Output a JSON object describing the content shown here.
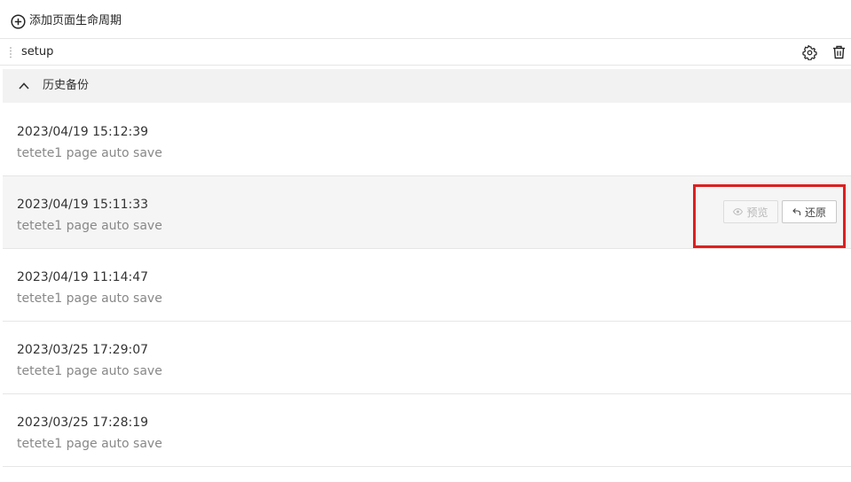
{
  "toolbar": {
    "add_label": "添加页面生命周期",
    "add_icon": "plus-circle-icon"
  },
  "setup": {
    "label": "setup",
    "settings_icon": "gear-icon",
    "delete_icon": "trash-icon"
  },
  "history": {
    "title": "历史备份",
    "expanded": true,
    "items": [
      {
        "time": "2023/04/19 15:12:39",
        "desc": "tetete1 page auto save"
      },
      {
        "time": "2023/04/19 15:11:33",
        "desc": "tetete1 page auto save",
        "hovered": true
      },
      {
        "time": "2023/04/19 11:14:47",
        "desc": "tetete1 page auto save"
      },
      {
        "time": "2023/03/25 17:29:07",
        "desc": "tetete1 page auto save"
      },
      {
        "time": "2023/03/25 17:28:19",
        "desc": "tetete1 page auto save"
      }
    ],
    "actions": {
      "preview_label": "预览",
      "preview_icon": "eye-icon",
      "preview_disabled": true,
      "restore_label": "还原",
      "restore_icon": "undo-arrow-icon"
    }
  },
  "colors": {
    "highlight": "#dd1f1f",
    "header_bg": "#f2f2f2",
    "hover_bg": "#f5f5f5"
  }
}
